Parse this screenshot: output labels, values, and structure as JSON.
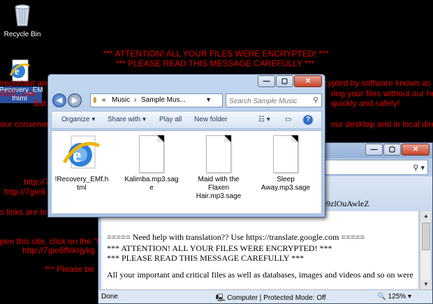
{
  "desktop": {
    "icons": [
      {
        "label": "Recycle Bin"
      },
      {
        "label": "!Recovery_EM fhtml"
      }
    ],
    "ransom_lines": [
      "*** ATTENTION! ALL YOUR FILES WERE ENCRYPTED! ***",
      "*** PLEASE READ THIS MESSAGE CAREFULLY ***",
      "important and critical files as well as databases, images and videos and so on were encrypted by software known as",
      "AGE, use",
      "ring your files without our help",
      "But l",
      "quickly and safely!",
      "our convenie",
      "our desktop and in local direct",
      "http://7gi",
      "http://7gie6",
      "s links are te",
      "pen this site, click on the \"li",
      "http://7gie6ffnkrjykg",
      "*** Please be"
    ]
  },
  "explorer": {
    "breadcrumb": [
      "«",
      "Music",
      "›",
      "Sample Mus...",
      "▾"
    ],
    "search_placeholder": "Search Sample Music",
    "commands": [
      "Organize ▾",
      "Share with ▾",
      "Play all",
      "New folder"
    ],
    "files": [
      {
        "name": "!Recovery_EMf.html",
        "type": "html"
      },
      {
        "name": "Kalimba.mp3.sage",
        "type": "sage"
      },
      {
        "name": "Maid with the Flaxen Hair.mp3.sage",
        "type": "sage"
      },
      {
        "name": "Sleep Away.mp3.sage",
        "type": "sage"
      }
    ]
  },
  "ie": {
    "partial_text": "b9zlOuAwleZ",
    "lines": [
      "===== Need help with translation?? Use https://translate.google.com =====",
      "*** ATTENTION! ALL YOUR FILES WERE ENCRYPTED! ***",
      "*** PLEASE READ THIS MESSAGE CAREFULLY ***",
      "All your important and critical files as well as databases, images and videos and so on were"
    ],
    "status": {
      "done": "Done",
      "zone": "Computer | Protected Mode: Off",
      "zoom": "125%"
    }
  },
  "colors": {
    "ransom_text": "#e00000",
    "desktop_bg": "#000000"
  }
}
